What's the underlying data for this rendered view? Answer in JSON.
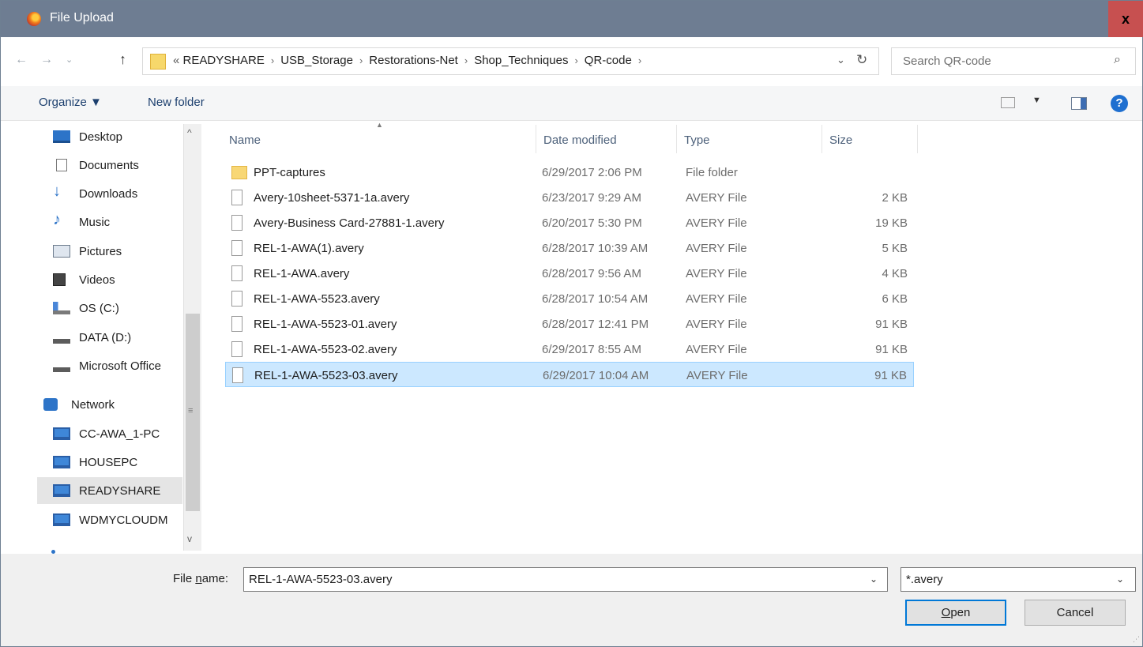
{
  "window": {
    "title": "File Upload",
    "close_label": "x"
  },
  "address": {
    "overflow": "«",
    "crumbs": [
      "READYSHARE",
      "USB_Storage",
      "Restorations-Net",
      "Shop_Techniques",
      "QR-code"
    ],
    "separator": "›"
  },
  "search": {
    "placeholder": "Search QR-code"
  },
  "toolbar": {
    "organize": "Organize ▼",
    "new_folder": "New folder"
  },
  "nav": {
    "items": [
      {
        "label": "Desktop",
        "icon": "desktop-icon"
      },
      {
        "label": "Documents",
        "icon": "documents-icon"
      },
      {
        "label": "Downloads",
        "icon": "downloads-icon"
      },
      {
        "label": "Music",
        "icon": "music-icon"
      },
      {
        "label": "Pictures",
        "icon": "pictures-icon"
      },
      {
        "label": "Videos",
        "icon": "videos-icon"
      },
      {
        "label": "OS (C:)",
        "icon": "os-drive-icon"
      },
      {
        "label": "DATA (D:)",
        "icon": "drive-icon"
      },
      {
        "label": "Microsoft Office",
        "icon": "drive-icon"
      },
      {
        "label": "Network",
        "icon": "network-icon"
      },
      {
        "label": "CC-AWA_1-PC",
        "icon": "computer-icon"
      },
      {
        "label": "HOUSEPC",
        "icon": "computer-icon"
      },
      {
        "label": "READYSHARE",
        "icon": "computer-icon",
        "selected": true
      },
      {
        "label": "WDMYCLOUDM",
        "icon": "computer-icon"
      }
    ]
  },
  "columns": {
    "name": "Name",
    "date": "Date modified",
    "type": "Type",
    "size": "Size"
  },
  "files": [
    {
      "name": "PPT-captures",
      "date": "6/29/2017 2:06 PM",
      "type": "File folder",
      "size": ""
    },
    {
      "name": "Avery-10sheet-5371-1a.avery",
      "date": "6/23/2017 9:29 AM",
      "type": "AVERY File",
      "size": "2 KB"
    },
    {
      "name": "Avery-Business Card-27881-1.avery",
      "date": "6/20/2017 5:30 PM",
      "type": "AVERY File",
      "size": "19 KB"
    },
    {
      "name": "REL-1-AWA(1).avery",
      "date": "6/28/2017 10:39 AM",
      "type": "AVERY File",
      "size": "5 KB"
    },
    {
      "name": "REL-1-AWA.avery",
      "date": "6/28/2017 9:56 AM",
      "type": "AVERY File",
      "size": "4 KB"
    },
    {
      "name": "REL-1-AWA-5523.avery",
      "date": "6/28/2017 10:54 AM",
      "type": "AVERY File",
      "size": "6 KB"
    },
    {
      "name": "REL-1-AWA-5523-01.avery",
      "date": "6/28/2017 12:41 PM",
      "type": "AVERY File",
      "size": "91 KB"
    },
    {
      "name": "REL-1-AWA-5523-02.avery",
      "date": "6/29/2017 8:55 AM",
      "type": "AVERY File",
      "size": "91 KB"
    },
    {
      "name": "REL-1-AWA-5523-03.avery",
      "date": "6/29/2017 10:04 AM",
      "type": "AVERY File",
      "size": "91 KB",
      "selected": true
    }
  ],
  "bottom": {
    "file_name_label_pre": "File ",
    "file_name_label_u": "n",
    "file_name_label_post": "ame:",
    "file_name_value": "REL-1-AWA-5523-03.avery",
    "filter_value": "*.avery",
    "open_u": "O",
    "open_rest": "pen",
    "cancel": "Cancel"
  }
}
